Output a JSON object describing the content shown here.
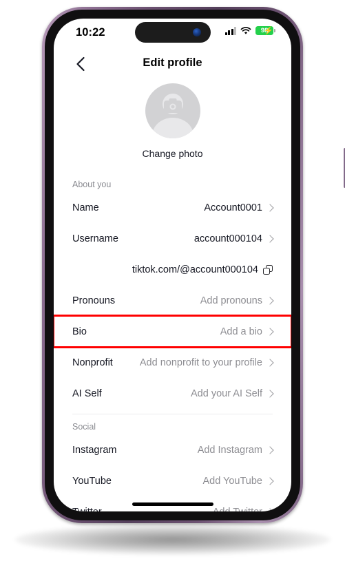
{
  "status_bar": {
    "time": "10:22",
    "signal_icon": "cellular-signal-icon",
    "wifi_icon": "wifi-icon",
    "battery_percent": "98",
    "battery_charging_glyph": "⚡"
  },
  "header": {
    "back_icon": "back-chevron-icon",
    "title": "Edit profile"
  },
  "profile": {
    "avatar_icon": "avatar-placeholder-icon",
    "camera_icon": "camera-icon",
    "change_photo_label": "Change photo"
  },
  "sections": [
    {
      "title": "About you",
      "rows": [
        {
          "label": "Name",
          "value": "Account0001",
          "value_style": "filled",
          "accessory": "chevron"
        },
        {
          "label": "Username",
          "value": "account000104",
          "value_style": "filled",
          "accessory": "chevron"
        },
        {
          "label": "",
          "value": "tiktok.com/@account000104",
          "value_style": "filled",
          "accessory": "copy"
        },
        {
          "label": "Pronouns",
          "value": "Add pronouns",
          "value_style": "placeholder",
          "accessory": "chevron"
        },
        {
          "label": "Bio",
          "value": "Add a bio",
          "value_style": "placeholder",
          "accessory": "chevron",
          "highlighted": true
        },
        {
          "label": "Nonprofit",
          "value": "Add nonprofit to your profile",
          "value_style": "placeholder",
          "accessory": "chevron"
        },
        {
          "label": "AI Self",
          "value": "Add your AI Self",
          "value_style": "placeholder",
          "accessory": "chevron"
        }
      ]
    },
    {
      "title": "Social",
      "rows": [
        {
          "label": "Instagram",
          "value": "Add Instagram",
          "value_style": "placeholder",
          "accessory": "chevron"
        },
        {
          "label": "YouTube",
          "value": "Add YouTube",
          "value_style": "placeholder",
          "accessory": "chevron"
        },
        {
          "label": "Twitter",
          "value": "Add Twitter",
          "value_style": "placeholder",
          "accessory": "chevron"
        }
      ]
    }
  ],
  "highlight": {
    "color": "#FF0000",
    "target": "Bio"
  },
  "device": {
    "frame_color": "#6d5272",
    "buttons": [
      "silent-switch",
      "volume-up-button",
      "volume-down-button",
      "power-button"
    ],
    "home_indicator": "home-indicator"
  }
}
